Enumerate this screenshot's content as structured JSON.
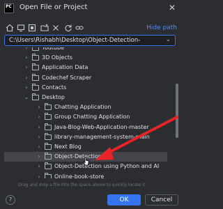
{
  "window": {
    "logo_text": "PC",
    "title": "Open File or Project",
    "close_glyph": "✕"
  },
  "toolbar": {
    "icons": [
      "home-icon",
      "desktop-icon",
      "project-icon",
      "new-folder-icon",
      "delete-icon",
      "refresh-icon",
      "link-icon"
    ],
    "hide_path_label": "Hide path"
  },
  "path_input": {
    "value": "C:\\Users\\Rishabh\\Desktop\\Object-Detection-"
  },
  "tree": {
    "items": [
      {
        "label": "Youtube",
        "depth": 3,
        "expanded": false,
        "partial": true
      },
      {
        "label": "3D Objects",
        "depth": 3,
        "expanded": false
      },
      {
        "label": "Application Data",
        "depth": 3,
        "expanded": false
      },
      {
        "label": "Codechef Scraper",
        "depth": 3,
        "expanded": false
      },
      {
        "label": "Contacts",
        "depth": 3,
        "expanded": false
      },
      {
        "label": "Desktop",
        "depth": 3,
        "expanded": true
      },
      {
        "label": "Chatting Application",
        "depth": 4,
        "expanded": false
      },
      {
        "label": "Group Chatting Application",
        "depth": 4,
        "expanded": false
      },
      {
        "label": "Java-Blog-Web-Application-master",
        "depth": 4,
        "expanded": false
      },
      {
        "label": "library-management-system-main",
        "depth": 4,
        "expanded": false
      },
      {
        "label": "Next Blog",
        "depth": 4,
        "expanded": false
      },
      {
        "label": "Object-Detection-",
        "depth": 4,
        "expanded": false,
        "selected": true
      },
      {
        "label": "Object-Detection using Python and AI",
        "depth": 4,
        "expanded": false
      },
      {
        "label": "Online-book-store",
        "depth": 4,
        "expanded": false
      }
    ]
  },
  "hint_text": "Drag and drop a file into the space above to quickly locate it",
  "buttons": {
    "help": "?",
    "ok": "OK",
    "cancel": "Cancel"
  },
  "colors": {
    "background": "#2b2d30",
    "accent": "#3574f0",
    "link": "#548af7",
    "annotation_arrow": "#e8232a"
  }
}
